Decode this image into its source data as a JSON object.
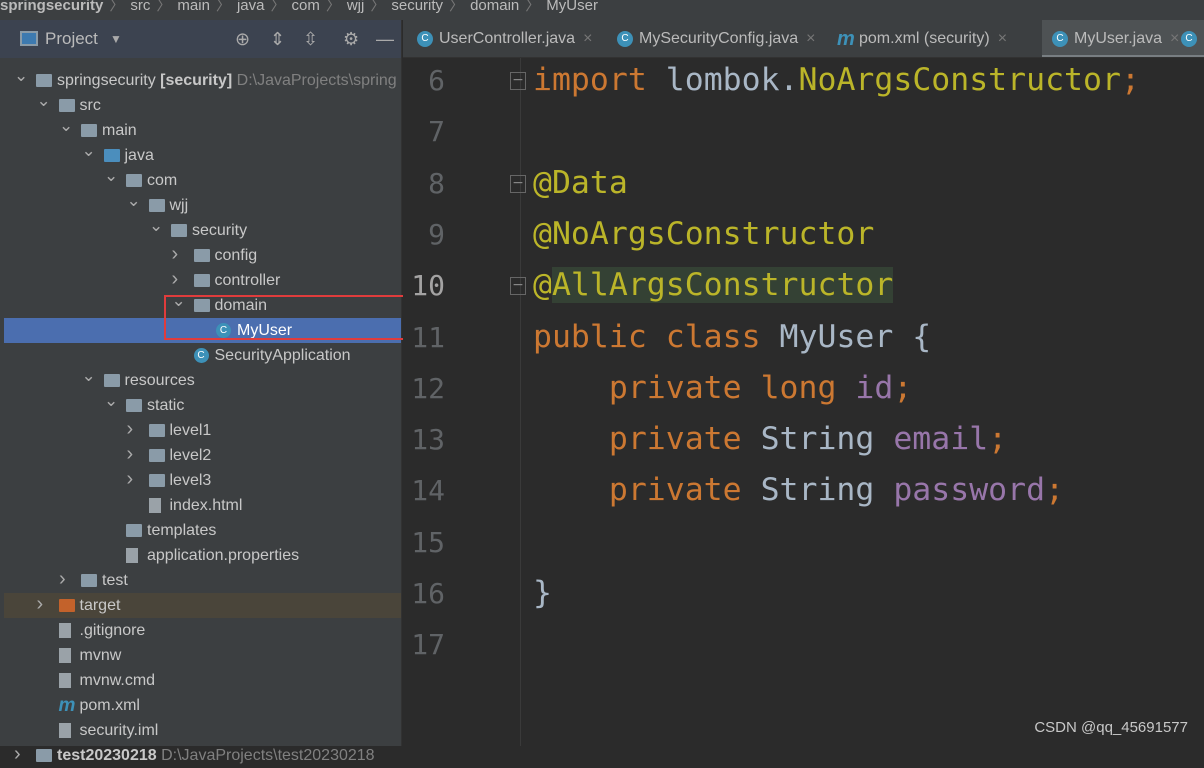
{
  "breadcrumb": [
    "springsecurity",
    "src",
    "main",
    "java",
    "com",
    "wjj",
    "security",
    "domain",
    "MyUser"
  ],
  "project_panel": {
    "title": "Project",
    "icons": [
      "locate-icon",
      "expand-all-icon",
      "collapse-all-icon",
      "gear-icon",
      "minimize-icon"
    ]
  },
  "tree": [
    {
      "label": "springsecurity",
      "bold": "[security]",
      "path": "D:\\JavaProjects\\spring",
      "level": 0,
      "arrow": "v",
      "icon": "module"
    },
    {
      "label": "src",
      "level": 1,
      "arrow": "v",
      "icon": "folder"
    },
    {
      "label": "main",
      "level": 2,
      "arrow": "v",
      "icon": "folder"
    },
    {
      "label": "java",
      "level": 3,
      "arrow": "v",
      "icon": "src"
    },
    {
      "label": "com",
      "level": 4,
      "arrow": "v",
      "icon": "package"
    },
    {
      "label": "wjj",
      "level": 5,
      "arrow": "v",
      "icon": "package"
    },
    {
      "label": "security",
      "level": 6,
      "arrow": "v",
      "icon": "package"
    },
    {
      "label": "config",
      "level": 7,
      "arrow": ">",
      "icon": "package"
    },
    {
      "label": "controller",
      "level": 7,
      "arrow": ">",
      "icon": "package"
    },
    {
      "label": "domain",
      "level": 7,
      "arrow": "v",
      "icon": "package"
    },
    {
      "label": "MyUser",
      "level": 8,
      "arrow": "",
      "icon": "class",
      "selected": true
    },
    {
      "label": "SecurityApplication",
      "level": 7,
      "arrow": "",
      "icon": "class"
    },
    {
      "label": "resources",
      "level": 3,
      "arrow": "v",
      "icon": "folder"
    },
    {
      "label": "static",
      "level": 4,
      "arrow": "v",
      "icon": "folder"
    },
    {
      "label": "level1",
      "level": 5,
      "arrow": ">",
      "icon": "folder"
    },
    {
      "label": "level2",
      "level": 5,
      "arrow": ">",
      "icon": "folder"
    },
    {
      "label": "level3",
      "level": 5,
      "arrow": ">",
      "icon": "folder"
    },
    {
      "label": "index.html",
      "level": 5,
      "arrow": "",
      "icon": "file"
    },
    {
      "label": "templates",
      "level": 4,
      "arrow": "",
      "icon": "folder"
    },
    {
      "label": "application.properties",
      "level": 4,
      "arrow": "",
      "icon": "file"
    },
    {
      "label": "test",
      "level": 2,
      "arrow": ">",
      "icon": "folder"
    },
    {
      "label": "target",
      "level": 1,
      "arrow": ">",
      "icon": "excluded",
      "excluded": true
    },
    {
      "label": ".gitignore",
      "level": 1,
      "arrow": "",
      "icon": "file"
    },
    {
      "label": "mvnw",
      "level": 1,
      "arrow": "",
      "icon": "file"
    },
    {
      "label": "mvnw.cmd",
      "level": 1,
      "arrow": "",
      "icon": "file"
    },
    {
      "label": "pom.xml",
      "level": 1,
      "arrow": "",
      "icon": "maven"
    },
    {
      "label": "security.iml",
      "level": 1,
      "arrow": "",
      "icon": "file"
    },
    {
      "label": "test20230218",
      "path": "D:\\JavaProjects\\test20230218",
      "level": 0,
      "arrow": ">",
      "icon": "folder"
    }
  ],
  "tabs": [
    {
      "label": "UserController.java",
      "icon": "class"
    },
    {
      "label": "MySecurityConfig.java",
      "icon": "class"
    },
    {
      "label": "pom.xml (security)",
      "icon": "maven"
    },
    {
      "label": "MyUser.java",
      "icon": "class",
      "active": true
    }
  ],
  "editor": {
    "current_line": 10,
    "lines": [
      {
        "n": "6",
        "tokens": [
          [
            "kw",
            "import "
          ],
          [
            "",
            "lombok."
          ],
          [
            "an",
            "NoArgsConstructor"
          ],
          [
            "kw",
            ";"
          ]
        ],
        "fold": true
      },
      {
        "n": "7",
        "tokens": []
      },
      {
        "n": "8",
        "tokens": [
          [
            "an",
            "@Data"
          ]
        ],
        "fold": true
      },
      {
        "n": "9",
        "tokens": [
          [
            "an",
            "@NoArgsConstructor"
          ]
        ]
      },
      {
        "n": "10",
        "tokens": [
          [
            "an",
            "@"
          ],
          [
            "an hl",
            "AllArgsConstructor"
          ]
        ],
        "fold": true
      },
      {
        "n": "11",
        "tokens": [
          [
            "kw",
            "public class "
          ],
          [
            "",
            "MyUser {"
          ]
        ]
      },
      {
        "n": "12",
        "tokens": [
          [
            "",
            "    "
          ],
          [
            "kw",
            "private long "
          ],
          [
            "fd",
            "id"
          ],
          [
            "kw",
            ";"
          ]
        ]
      },
      {
        "n": "13",
        "tokens": [
          [
            "",
            "    "
          ],
          [
            "kw",
            "private "
          ],
          [
            "",
            "String "
          ],
          [
            "fd",
            "email"
          ],
          [
            "kw",
            ";"
          ]
        ]
      },
      {
        "n": "14",
        "tokens": [
          [
            "",
            "    "
          ],
          [
            "kw",
            "private "
          ],
          [
            "",
            "String "
          ],
          [
            "fd",
            "password"
          ],
          [
            "kw",
            ";"
          ]
        ]
      },
      {
        "n": "15",
        "tokens": []
      },
      {
        "n": "16",
        "tokens": [
          [
            "",
            "}"
          ]
        ]
      },
      {
        "n": "17",
        "tokens": []
      }
    ]
  },
  "watermark": "CSDN @qq_45691577"
}
